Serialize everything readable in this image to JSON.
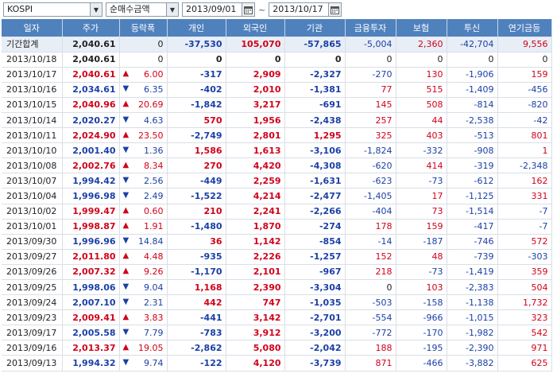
{
  "toolbar": {
    "market": "KOSPI",
    "type": "순매수금액",
    "date_from": "2013/09/01",
    "date_to": "2013/10/17",
    "separator": "~"
  },
  "columns": [
    "일자",
    "주가",
    "등락폭",
    "개인",
    "외국인",
    "기관",
    "금융투자",
    "보험",
    "투신",
    "연기금등"
  ],
  "summary": {
    "date": "기간합계",
    "price": "2,040.61",
    "change": "0",
    "indiv": "-37,530",
    "foreign": "105,070",
    "inst": "-57,865",
    "fin": "-5,004",
    "ins": "2,360",
    "trust": "-42,704",
    "pension": "9,556"
  },
  "rows": [
    {
      "date": "2013/10/18",
      "price": "2,040.61",
      "dir": "",
      "change": "0",
      "indiv": "0",
      "foreign": "0",
      "inst": "0",
      "fin": "0",
      "ins": "0",
      "trust": "0",
      "pension": "0"
    },
    {
      "date": "2013/10/17",
      "price": "2,040.61",
      "dir": "up",
      "change": "6.00",
      "indiv": "-317",
      "foreign": "2,909",
      "inst": "-2,327",
      "fin": "-270",
      "ins": "130",
      "trust": "-1,906",
      "pension": "159"
    },
    {
      "date": "2013/10/16",
      "price": "2,034.61",
      "dir": "down",
      "change": "6.35",
      "indiv": "-402",
      "foreign": "2,010",
      "inst": "-1,381",
      "fin": "77",
      "ins": "515",
      "trust": "-1,409",
      "pension": "-456"
    },
    {
      "date": "2013/10/15",
      "price": "2,040.96",
      "dir": "up",
      "change": "20.69",
      "indiv": "-1,842",
      "foreign": "3,217",
      "inst": "-691",
      "fin": "145",
      "ins": "508",
      "trust": "-814",
      "pension": "-820"
    },
    {
      "date": "2013/10/14",
      "price": "2,020.27",
      "dir": "down",
      "change": "4.63",
      "indiv": "570",
      "foreign": "1,956",
      "inst": "-2,438",
      "fin": "257",
      "ins": "44",
      "trust": "-2,538",
      "pension": "-42"
    },
    {
      "date": "2013/10/11",
      "price": "2,024.90",
      "dir": "up",
      "change": "23.50",
      "indiv": "-2,749",
      "foreign": "2,801",
      "inst": "1,295",
      "fin": "325",
      "ins": "403",
      "trust": "-513",
      "pension": "801"
    },
    {
      "date": "2013/10/10",
      "price": "2,001.40",
      "dir": "down",
      "change": "1.36",
      "indiv": "1,586",
      "foreign": "1,613",
      "inst": "-3,106",
      "fin": "-1,824",
      "ins": "-332",
      "trust": "-908",
      "pension": "1"
    },
    {
      "date": "2013/10/08",
      "price": "2,002.76",
      "dir": "up",
      "change": "8.34",
      "indiv": "270",
      "foreign": "4,420",
      "inst": "-4,308",
      "fin": "-620",
      "ins": "414",
      "trust": "-319",
      "pension": "-2,348"
    },
    {
      "date": "2013/10/07",
      "price": "1,994.42",
      "dir": "down",
      "change": "2.56",
      "indiv": "-449",
      "foreign": "2,259",
      "inst": "-1,631",
      "fin": "-623",
      "ins": "-73",
      "trust": "-612",
      "pension": "162"
    },
    {
      "date": "2013/10/04",
      "price": "1,996.98",
      "dir": "down",
      "change": "2.49",
      "indiv": "-1,522",
      "foreign": "4,214",
      "inst": "-2,477",
      "fin": "-1,405",
      "ins": "17",
      "trust": "-1,125",
      "pension": "331"
    },
    {
      "date": "2013/10/02",
      "price": "1,999.47",
      "dir": "up",
      "change": "0.60",
      "indiv": "210",
      "foreign": "2,241",
      "inst": "-2,266",
      "fin": "-404",
      "ins": "73",
      "trust": "-1,514",
      "pension": "-7"
    },
    {
      "date": "2013/10/01",
      "price": "1,998.87",
      "dir": "up",
      "change": "1.91",
      "indiv": "-1,480",
      "foreign": "1,870",
      "inst": "-274",
      "fin": "178",
      "ins": "159",
      "trust": "-417",
      "pension": "-7"
    },
    {
      "date": "2013/09/30",
      "price": "1,996.96",
      "dir": "down",
      "change": "14.84",
      "indiv": "36",
      "foreign": "1,142",
      "inst": "-854",
      "fin": "-14",
      "ins": "-187",
      "trust": "-746",
      "pension": "572"
    },
    {
      "date": "2013/09/27",
      "price": "2,011.80",
      "dir": "up",
      "change": "4.48",
      "indiv": "-935",
      "foreign": "2,226",
      "inst": "-1,257",
      "fin": "152",
      "ins": "48",
      "trust": "-739",
      "pension": "-303"
    },
    {
      "date": "2013/09/26",
      "price": "2,007.32",
      "dir": "up",
      "change": "9.26",
      "indiv": "-1,170",
      "foreign": "2,101",
      "inst": "-967",
      "fin": "218",
      "ins": "-73",
      "trust": "-1,419",
      "pension": "359"
    },
    {
      "date": "2013/09/25",
      "price": "1,998.06",
      "dir": "down",
      "change": "9.04",
      "indiv": "1,168",
      "foreign": "2,390",
      "inst": "-3,304",
      "fin": "0",
      "ins": "103",
      "trust": "-2,383",
      "pension": "504"
    },
    {
      "date": "2013/09/24",
      "price": "2,007.10",
      "dir": "down",
      "change": "2.31",
      "indiv": "442",
      "foreign": "747",
      "inst": "-1,035",
      "fin": "-503",
      "ins": "-158",
      "trust": "-1,138",
      "pension": "1,732"
    },
    {
      "date": "2013/09/23",
      "price": "2,009.41",
      "dir": "up",
      "change": "3.83",
      "indiv": "-441",
      "foreign": "3,142",
      "inst": "-2,701",
      "fin": "-554",
      "ins": "-966",
      "trust": "-1,015",
      "pension": "323"
    },
    {
      "date": "2013/09/17",
      "price": "2,005.58",
      "dir": "down",
      "change": "7.79",
      "indiv": "-783",
      "foreign": "3,912",
      "inst": "-3,200",
      "fin": "-772",
      "ins": "-170",
      "trust": "-1,982",
      "pension": "542"
    },
    {
      "date": "2013/09/16",
      "price": "2,013.37",
      "dir": "up",
      "change": "19.05",
      "indiv": "-2,862",
      "foreign": "5,080",
      "inst": "-2,042",
      "fin": "188",
      "ins": "-195",
      "trust": "-2,390",
      "pension": "971"
    },
    {
      "date": "2013/09/13",
      "price": "1,994.32",
      "dir": "down",
      "change": "9.74",
      "indiv": "-122",
      "foreign": "4,120",
      "inst": "-3,739",
      "fin": "871",
      "ins": "-466",
      "trust": "-3,882",
      "pension": "625"
    }
  ],
  "colors": {
    "header": "#4f81bd",
    "up": "#d0021b",
    "down": "#1a3fa8"
  }
}
